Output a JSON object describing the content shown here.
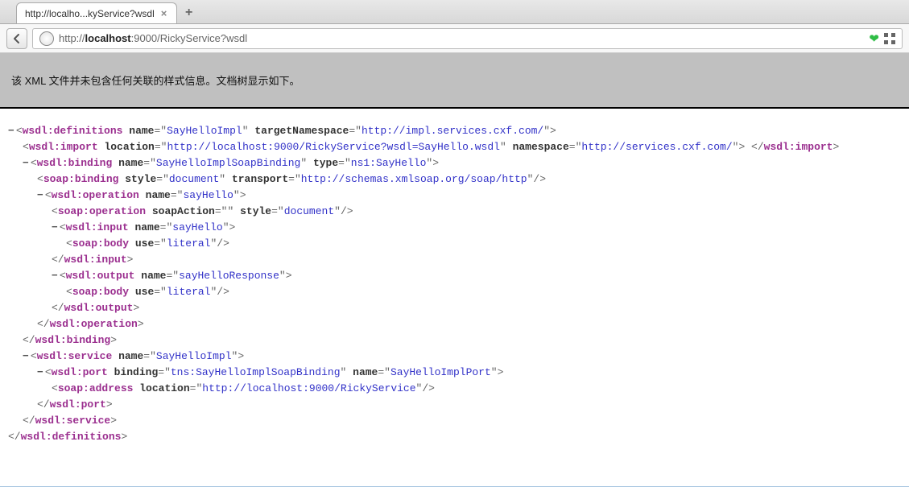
{
  "tab": {
    "title": "http://localho...kyService?wsdl"
  },
  "url": {
    "prefix": "http://",
    "host": "localhost",
    "suffix": ":9000/RickyService?wsdl"
  },
  "notice": "该 XML 文件并未包含任何关联的样式信息。文档树显示如下。",
  "xml": {
    "definitions": {
      "tag": "wsdl:definitions",
      "name_attr": "name",
      "name_val": "SayHelloImpl",
      "tns_attr": "targetNamespace",
      "tns_val": "http://impl.services.cxf.com/"
    },
    "import": {
      "tag": "wsdl:import",
      "loc_attr": "location",
      "loc_val": "http://localhost:9000/RickyService?wsdl=SayHello.wsdl",
      "ns_attr": "namespace",
      "ns_val": "http://services.cxf.com/"
    },
    "binding": {
      "tag": "wsdl:binding",
      "name_attr": "name",
      "name_val": "SayHelloImplSoapBinding",
      "type_attr": "type",
      "type_val": "ns1:SayHello"
    },
    "soapBinding": {
      "tag": "soap:binding",
      "style_attr": "style",
      "style_val": "document",
      "trans_attr": "transport",
      "trans_val": "http://schemas.xmlsoap.org/soap/http"
    },
    "operation": {
      "tag": "wsdl:operation",
      "name_attr": "name",
      "name_val": "sayHello"
    },
    "soapOperation": {
      "tag": "soap:operation",
      "sa_attr": "soapAction",
      "sa_val": "",
      "style_attr": "style",
      "style_val": "document"
    },
    "input": {
      "tag": "wsdl:input",
      "name_attr": "name",
      "name_val": "sayHello"
    },
    "soapBodyIn": {
      "tag": "soap:body",
      "use_attr": "use",
      "use_val": "literal"
    },
    "output": {
      "tag": "wsdl:output",
      "name_attr": "name",
      "name_val": "sayHelloResponse"
    },
    "soapBodyOut": {
      "tag": "soap:body",
      "use_attr": "use",
      "use_val": "literal"
    },
    "service": {
      "tag": "wsdl:service",
      "name_attr": "name",
      "name_val": "SayHelloImpl"
    },
    "port": {
      "tag": "wsdl:port",
      "bind_attr": "binding",
      "bind_val": "tns:SayHelloImplSoapBinding",
      "name_attr": "name",
      "name_val": "SayHelloImplPort"
    },
    "soapAddress": {
      "tag": "soap:address",
      "loc_attr": "location",
      "loc_val": "http://localhost:9000/RickyService"
    },
    "close": {
      "input": "wsdl:input",
      "output": "wsdl:output",
      "operation": "wsdl:operation",
      "binding": "wsdl:binding",
      "port": "wsdl:port",
      "service": "wsdl:service",
      "definitions": "wsdl:definitions",
      "import": "wsdl:import"
    },
    "minus": "−"
  }
}
